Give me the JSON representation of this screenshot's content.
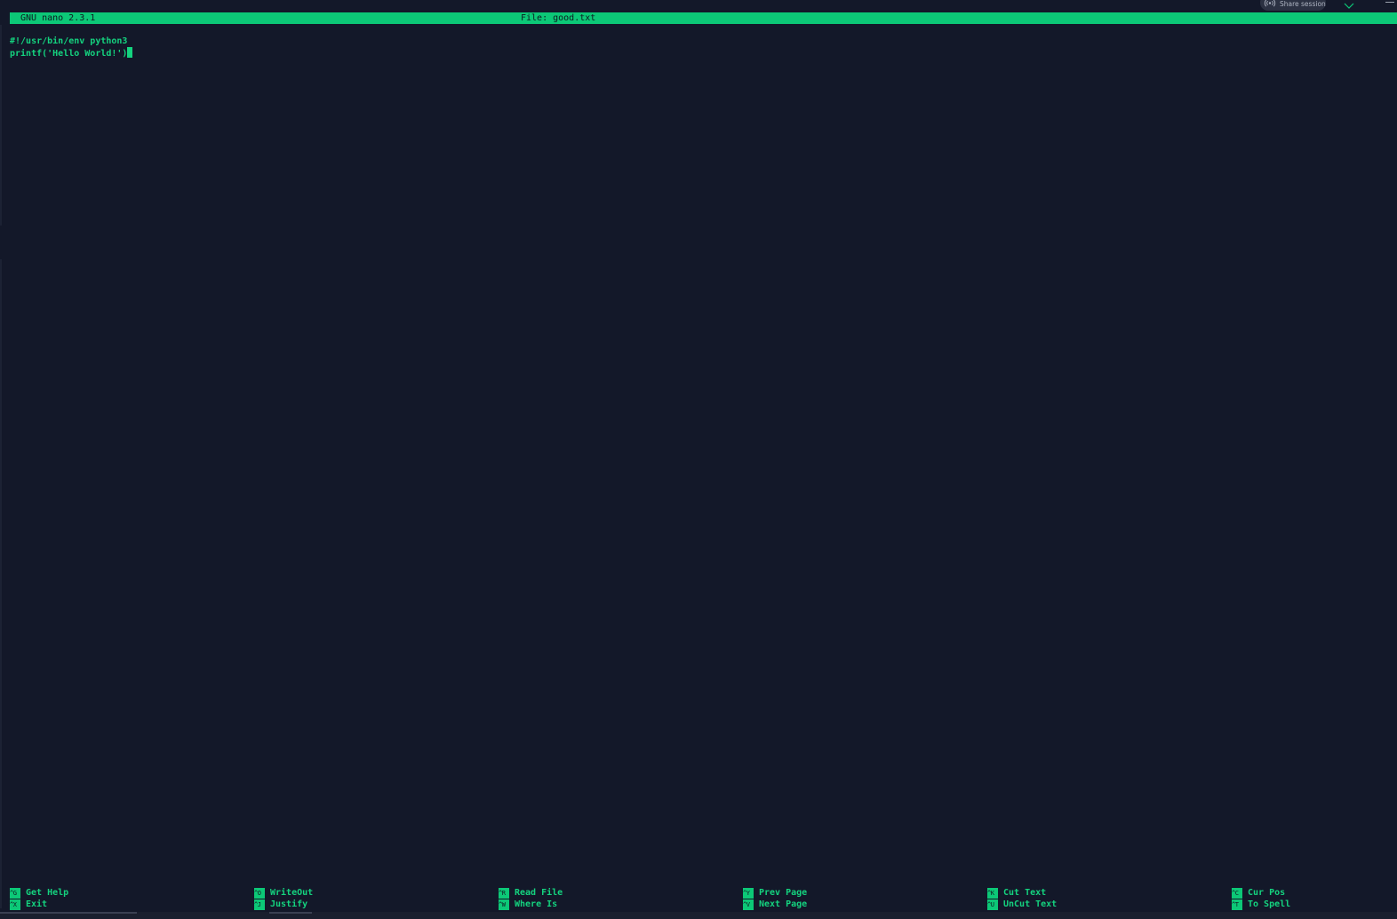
{
  "overlay": {
    "share_label": "Share session",
    "share_icon": "broadcast-icon",
    "chevron_icon": "chevron-down-icon",
    "accent_color": "#0cc877"
  },
  "title_bar": {
    "app_version": "GNU nano 2.3.1",
    "file_label": "File: good.txt"
  },
  "editor": {
    "lines": [
      "#!/usr/bin/env python3",
      "printf('Hello World!')"
    ]
  },
  "shortcuts": [
    {
      "top": {
        "key": "^G",
        "label": "Get Help"
      },
      "bottom": {
        "key": "^X",
        "label": "Exit"
      }
    },
    {
      "top": {
        "key": "^O",
        "label": "WriteOut"
      },
      "bottom": {
        "key": "^J",
        "label": "Justify"
      }
    },
    {
      "top": {
        "key": "^R",
        "label": "Read File"
      },
      "bottom": {
        "key": "^W",
        "label": "Where Is"
      }
    },
    {
      "top": {
        "key": "^Y",
        "label": "Prev Page"
      },
      "bottom": {
        "key": "^V",
        "label": "Next Page"
      }
    },
    {
      "top": {
        "key": "^K",
        "label": "Cut Text"
      },
      "bottom": {
        "key": "^U",
        "label": "UnCut Text"
      }
    },
    {
      "top": {
        "key": "^C",
        "label": "Cur Pos"
      },
      "bottom": {
        "key": "^T",
        "label": "To Spell"
      }
    }
  ]
}
